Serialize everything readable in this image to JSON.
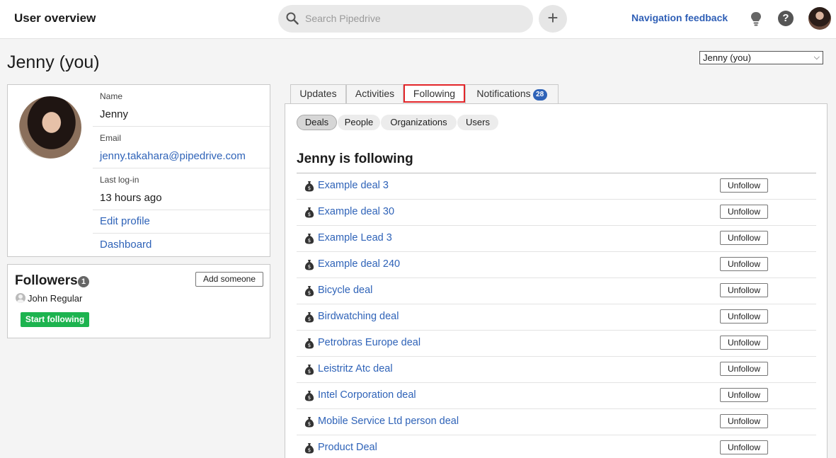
{
  "header": {
    "title": "User overview",
    "search_placeholder": "Search Pipedrive",
    "add_label": "+",
    "nav_feedback": "Navigation feedback",
    "help_label": "?"
  },
  "page": {
    "title": "Jenny (you)",
    "user_select_value": "Jenny (you)"
  },
  "profile": {
    "name_label": "Name",
    "name": "Jenny",
    "email_label": "Email",
    "email": "jenny.takahara@pipedrive.com",
    "last_login_label": "Last log-in",
    "last_login": "13 hours ago",
    "edit_profile": "Edit profile",
    "dashboard": "Dashboard"
  },
  "followers": {
    "title": "Followers",
    "count": "1",
    "add_label": "Add someone",
    "items": [
      {
        "name": "John Regular"
      }
    ],
    "start_following": "Start following"
  },
  "tabs": [
    {
      "label": "Updates"
    },
    {
      "label": "Activities"
    },
    {
      "label": "Following",
      "active": true
    },
    {
      "label": "Notifications",
      "badge": "28"
    }
  ],
  "subtabs": [
    {
      "label": "Deals",
      "active": true
    },
    {
      "label": "People"
    },
    {
      "label": "Organizations"
    },
    {
      "label": "Users"
    }
  ],
  "following": {
    "title": "Jenny is following",
    "unfollow_label": "Unfollow",
    "items": [
      {
        "name": "Example deal 3"
      },
      {
        "name": "Example deal 30"
      },
      {
        "name": "Example Lead 3"
      },
      {
        "name": "Example deal 240"
      },
      {
        "name": "Bicycle deal"
      },
      {
        "name": "Birdwatching deal"
      },
      {
        "name": "Petrobras Europe deal"
      },
      {
        "name": "Leistritz Atc deal"
      },
      {
        "name": "Intel Corporation deal"
      },
      {
        "name": "Mobile Service Ltd person deal"
      },
      {
        "name": "Product Deal"
      }
    ]
  },
  "icons": {
    "search": "search-icon",
    "bulb": "lightbulb-icon",
    "help": "help-icon",
    "deal": "money-bag-icon",
    "person": "person-icon"
  },
  "colors": {
    "link": "#2f63b8",
    "active_tab_border": "#e3262a",
    "start_following": "#1db34f",
    "badge": "#2f63b8"
  }
}
